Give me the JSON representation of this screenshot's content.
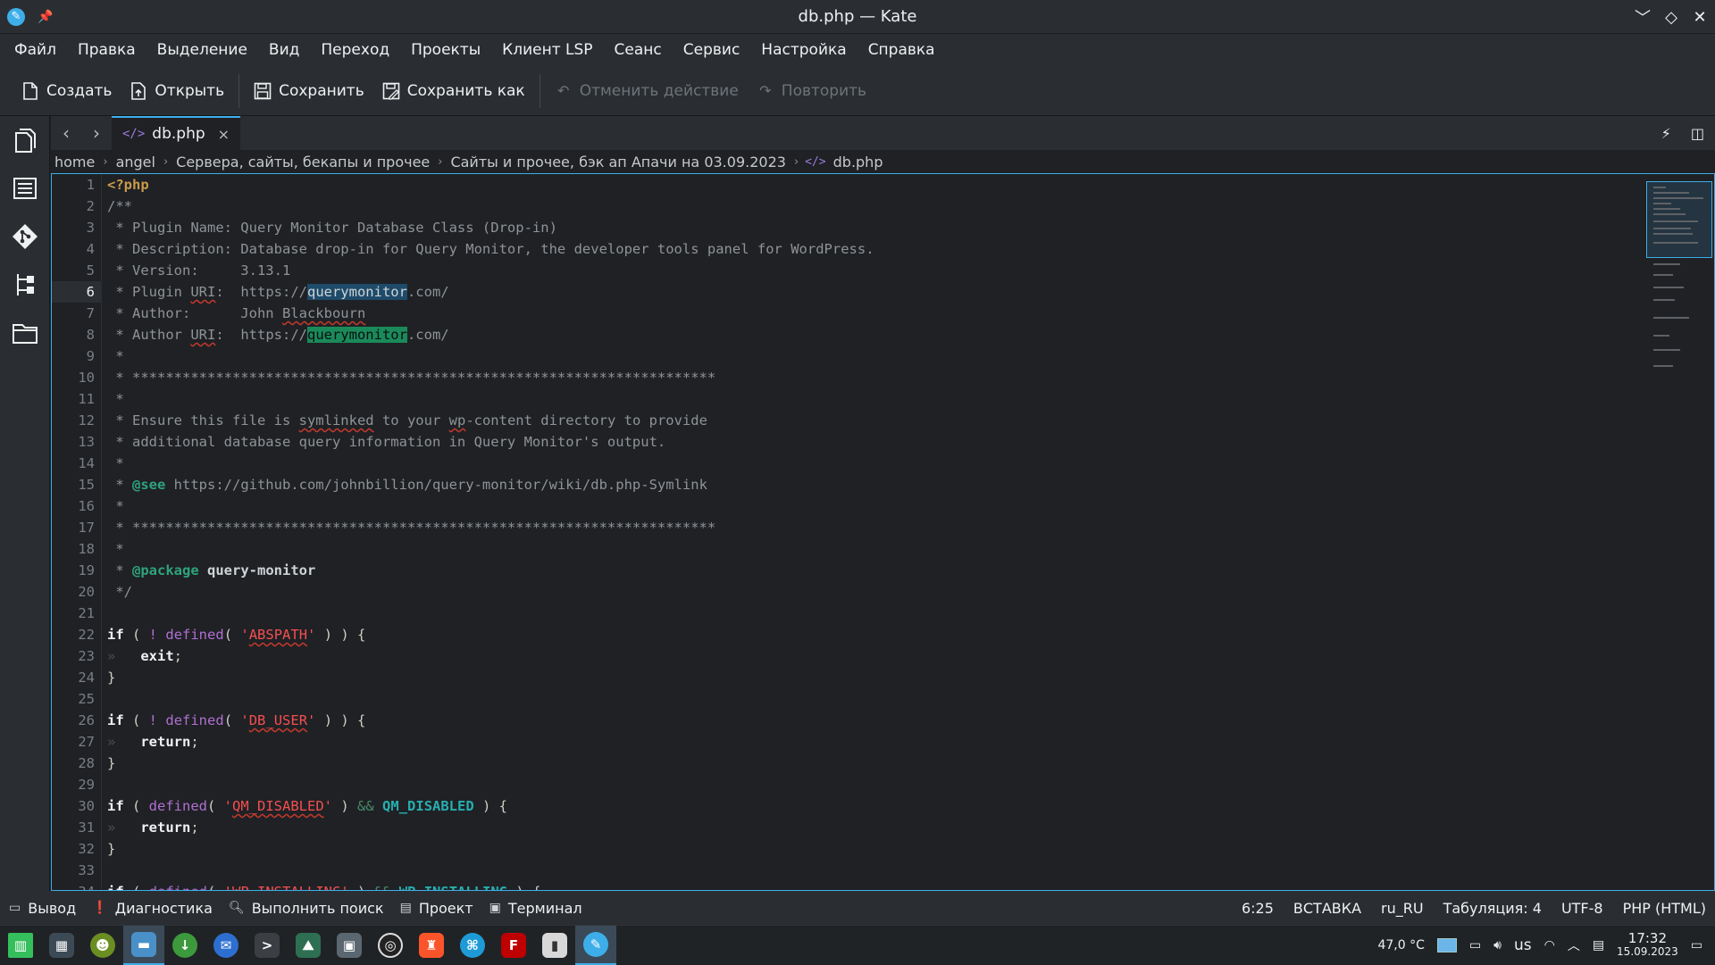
{
  "window": {
    "title": "db.php — Kate"
  },
  "menu": [
    "Файл",
    "Правка",
    "Выделение",
    "Вид",
    "Переход",
    "Проекты",
    "Клиент LSP",
    "Сеанс",
    "Сервис",
    "Настройка",
    "Справка"
  ],
  "toolbar": {
    "new_label": "Создать",
    "open_label": "Открыть",
    "save_label": "Сохранить",
    "save_as_label": "Сохранить как",
    "undo_label": "Отменить действие",
    "redo_label": "Повторить"
  },
  "tab": {
    "label": "db.php"
  },
  "breadcrumb": [
    "home",
    "angel",
    "Сервера, сайты, бекапы и прочее",
    "Сайты и прочее, бэк ап Апачи на 03.09.2023",
    "db.php"
  ],
  "editor": {
    "current_line": 6
  },
  "status": {
    "output": "Вывод",
    "diagnostics": "Диагностика",
    "search": "Выполнить поиск",
    "project": "Проект",
    "terminal": "Терминал",
    "cursor": "6:25",
    "mode": "ВСТАВКА",
    "dictionary": "ru_RU",
    "indent": "Табуляция: 4",
    "encoding": "UTF-8",
    "syntax": "PHP (HTML)"
  },
  "tray": {
    "temperature": "47,0 °C",
    "keyboard": "us",
    "time": "17:32",
    "date": "15.09.2023"
  }
}
